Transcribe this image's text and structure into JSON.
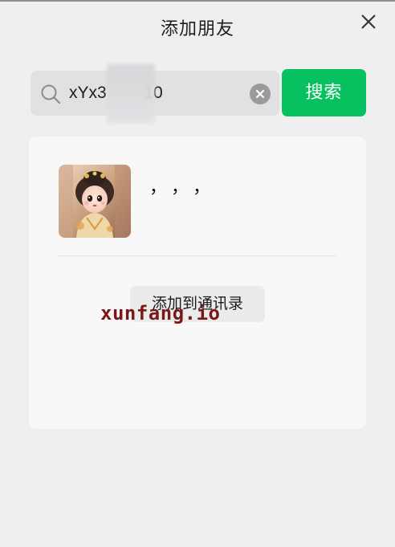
{
  "dialog": {
    "title": "添加朋友"
  },
  "search": {
    "value": "xYx3        10",
    "button_label": "搜索"
  },
  "result": {
    "nickname": "，，，",
    "add_button_label": "添加到通讯录"
  },
  "watermark": {
    "text": "xunfang.io"
  },
  "colors": {
    "accent": "#07c160",
    "background": "#efeff1",
    "card": "#f8f8f8"
  },
  "icons": [
    "close-icon",
    "search-icon",
    "clear-icon"
  ]
}
